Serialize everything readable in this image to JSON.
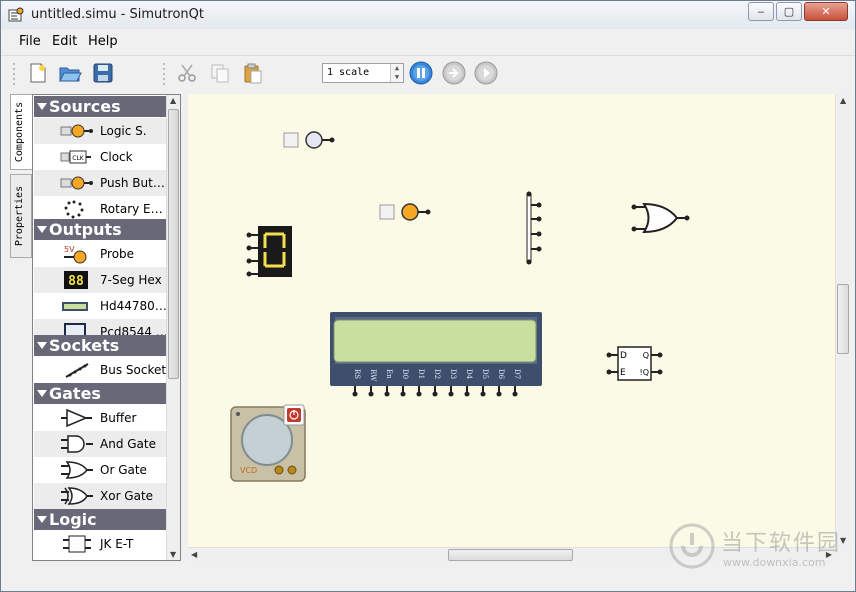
{
  "window": {
    "title": "untitled.simu - SimutronQt",
    "controls": {
      "minimize": "‒",
      "maximize": "▢",
      "close": "✕"
    }
  },
  "menu": [
    "File",
    "Edit",
    "Help"
  ],
  "toolbar": {
    "icons": [
      "new-file-icon",
      "open-folder-icon",
      "save-icon",
      "cut-icon",
      "copy-icon",
      "paste-icon",
      "pause-icon",
      "step-icon",
      "play-icon"
    ],
    "scale_value": "1 scale"
  },
  "side_tabs": [
    "Components",
    "Properties"
  ],
  "palette": {
    "categories": [
      {
        "name": "Sources",
        "items": [
          "Logic S.",
          "Clock",
          "Push But…",
          "Rotary E…"
        ]
      },
      {
        "name": "Outputs",
        "items": [
          "Probe",
          "7-Seg Hex",
          "Hd44780…",
          "Pcd8544 …"
        ]
      },
      {
        "name": "Sockets",
        "items": [
          "Bus Socket"
        ]
      },
      {
        "name": "Gates",
        "items": [
          "Buffer",
          "And Gate",
          "Or Gate",
          "Xor Gate"
        ]
      },
      {
        "name": "Logic",
        "items": [
          "JK E-T"
        ]
      }
    ],
    "icon_texts": {
      "clock": "CLK",
      "probe": "5V",
      "sevenseg": "88"
    }
  },
  "canvas": {
    "background": "#fafae6",
    "seven_seg_digit": "0",
    "lcd_pins": [
      "RS",
      "RW",
      "En",
      "D0",
      "D1",
      "D2",
      "D3",
      "D4",
      "D5",
      "D6",
      "D7"
    ],
    "ff_labels": [
      "D",
      "E",
      "Q",
      "!Q"
    ],
    "scope_label": "VCD"
  },
  "watermark": {
    "title": "当下软件园",
    "url": "www.downxia.com"
  },
  "colors": {
    "accent": "#686879",
    "led": "#f5a623",
    "lcd_green": "#c8dfa0",
    "lcd_frame": "#3e4f6e",
    "seg_on": "#f4e04c"
  }
}
